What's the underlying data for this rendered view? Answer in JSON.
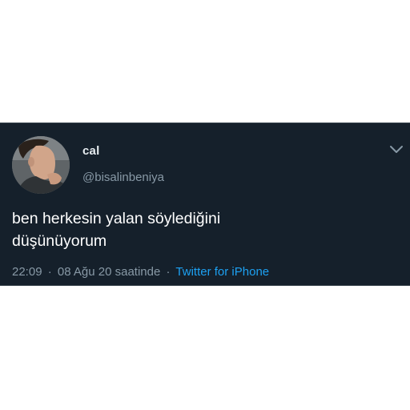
{
  "tweet": {
    "display_name": "cal",
    "handle": "@bisalinbeniya",
    "text": "ben herkesin yalan söylediğini\ndüşünüyorum",
    "time": "22:09",
    "separator": "·",
    "date": "08 Ağu 20 saatinde",
    "source": "Twitter for iPhone"
  },
  "icons": {
    "menu": "chevron-down-icon",
    "avatar": "profile-photo"
  },
  "colors": {
    "background": "#15202b",
    "name": "#e6ecf0",
    "secondary_text": "#8899a6",
    "tweet_text": "#ffffff",
    "link": "#1da1f2"
  }
}
